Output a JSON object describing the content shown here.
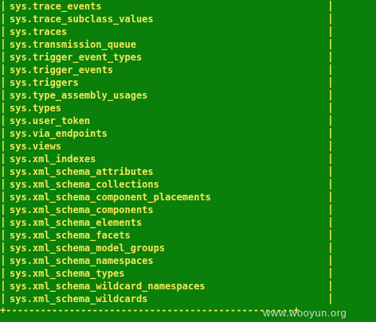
{
  "border": {
    "left": "|",
    "right": "|",
    "bottom": "+--------------------------------------------------+"
  },
  "rows": [
    "sys.trace_events",
    "sys.trace_subclass_values",
    "sys.traces",
    "sys.transmission_queue",
    "sys.trigger_event_types",
    "sys.trigger_events",
    "sys.triggers",
    "sys.type_assembly_usages",
    "sys.types",
    "sys.user_token",
    "sys.via_endpoints",
    "sys.views",
    "sys.xml_indexes",
    "sys.xml_schema_attributes",
    "sys.xml_schema_collections",
    "sys.xml_schema_component_placements",
    "sys.xml_schema_components",
    "sys.xml_schema_elements",
    "sys.xml_schema_facets",
    "sys.xml_schema_model_groups",
    "sys.xml_schema_namespaces",
    "sys.xml_schema_types",
    "sys.xml_schema_wildcard_namespaces",
    "sys.xml_schema_wildcards"
  ],
  "watermark": "www.wooyun.org",
  "colors": {
    "background": "#0a7f0a",
    "text": "#f3e85a",
    "watermark": "#d4d9d4"
  }
}
